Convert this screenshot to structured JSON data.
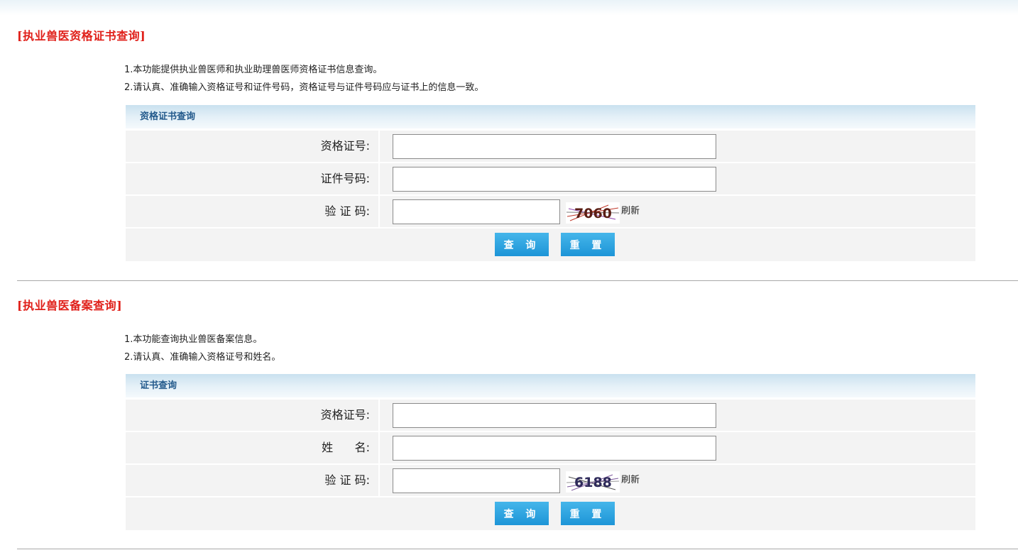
{
  "sections": [
    {
      "title": "[执业兽医资格证书查询]",
      "notes": [
        "1.本功能提供执业兽医师和执业助理兽医师资格证书信息查询。",
        "2.请认真、准确输入资格证号和证件号码，资格证号与证件号码应与证书上的信息一致。"
      ],
      "panel_title": "资格证书查询",
      "fields": [
        {
          "label": "资格证号:",
          "value": ""
        },
        {
          "label": "证件号码:",
          "value": ""
        }
      ],
      "captcha_label": "验 证 码:",
      "captcha_value": "",
      "captcha_text": "7060",
      "refresh_label": "刷新",
      "query_label": "查 询",
      "reset_label": "重 置"
    },
    {
      "title": "[执业兽医备案查询]",
      "notes": [
        "1.本功能查询执业兽医备案信息。",
        "2.请认真、准确输入资格证号和姓名。"
      ],
      "panel_title": "证书查询",
      "fields": [
        {
          "label": "资格证号:",
          "value": ""
        },
        {
          "label": "姓      名:",
          "value": ""
        }
      ],
      "captcha_label": "验 证 码:",
      "captcha_value": "",
      "captcha_text": "6188",
      "refresh_label": "刷新",
      "query_label": "查 询",
      "reset_label": "重 置"
    }
  ],
  "colors": {
    "title_red": "#e0201a",
    "panel_header_text": "#235a8c",
    "button_blue": "#1d95d7"
  }
}
